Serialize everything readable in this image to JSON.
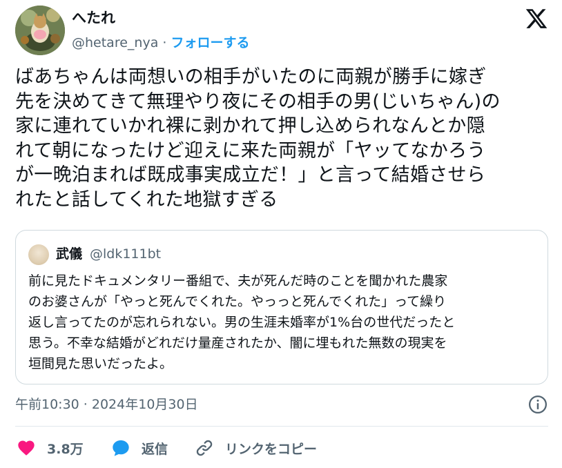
{
  "author": {
    "display_name": "へたれ",
    "handle": "@hetare_nya",
    "separator": "·",
    "follow_label": "フォローする"
  },
  "tweet": {
    "text": "ばあちゃんは両想いの相手がいたのに両親が勝手に嫁ぎ\n先を決めてきて無理やり夜にその相手の男(じいちゃん)の\n家に連れていかれ裸に剥かれて押し込められなんとか隠\nれて朝になったけど迎えに来た両親が「ヤッてなかろう\nが一晩泊まれば既成事実成立だ！」と言って結婚させら\nれたと話してくれた地獄すぎる",
    "timestamp": "午前10:30 · 2024年10月30日"
  },
  "quote": {
    "display_name": "武儀",
    "handle": "@ldk111bt",
    "text": "前に見たドキュメンタリー番組で、夫が死んだ時のことを聞かれた農家\nのお婆さんが「やっと死んでくれた。やっっと死んでくれた」って繰り\n返し言ってたのが忘れられない。男の生涯未婚率が1%台の世代だったと\n思う。不幸な結婚がどれだけ量産されたか、闇に埋もれた無数の現実を\n垣間見た思いだったよ。"
  },
  "actions": {
    "like_count": "3.8万",
    "reply_label": "返信",
    "copy_link_label": "リンクをコピー"
  },
  "icons": {
    "x_logo": "x-logo-icon",
    "info": "info-icon",
    "like": "heart-icon",
    "reply": "speech-bubble-icon",
    "link": "link-icon"
  },
  "colors": {
    "accent": "#1d9bf0",
    "like": "#f91880",
    "secondary_text": "#536471",
    "border": "#cfd9de"
  }
}
